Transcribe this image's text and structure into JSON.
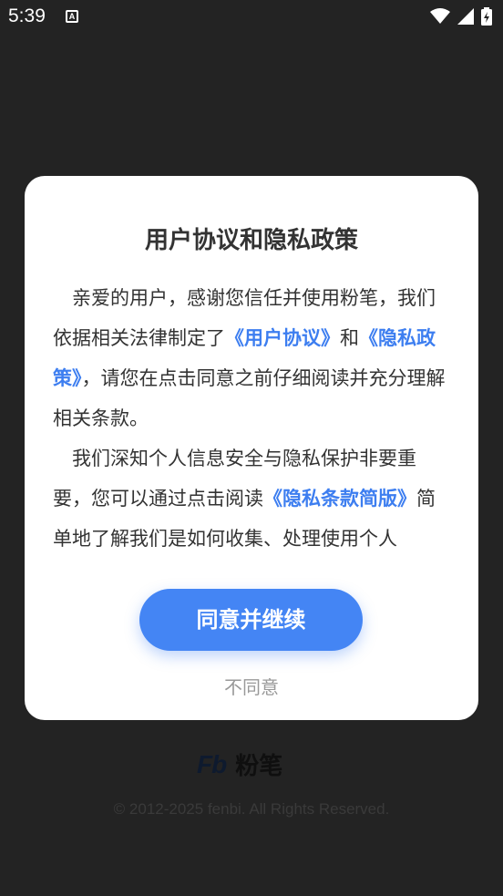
{
  "status_bar": {
    "time": "5:39",
    "notification_icon": "a-icon",
    "icons": [
      "wifi-icon",
      "signal-icon",
      "battery-charging-icon"
    ]
  },
  "dialog": {
    "title": "用户协议和隐私政策",
    "paragraph1": {
      "part1": "亲爱的用户，感谢您信任并使用粉笔，我们依据相关法律制定了",
      "link_user_agreement": "《用户协议》",
      "part2": "和",
      "link_privacy_policy": "《隐私政策》",
      "part3": "，请您在点击同意之前仔细阅读并充分理解相关条款。"
    },
    "paragraph2": {
      "part1": "我们深知个人信息安全与隐私保护非要重要，您可以通过点击阅读",
      "link_privacy_summary": "《隐私条款简版》",
      "part2": "简单地了解我们是如何收集、处理使用个人"
    },
    "agree_label": "同意并继续",
    "disagree_label": "不同意"
  },
  "background": {
    "brand_logo": "Fb",
    "brand_name": "粉笔",
    "copyright": "© 2012-2025 fenbi. All Rights Reserved."
  },
  "colors": {
    "accent": "#4485f4",
    "link": "#3d7ef0",
    "overlay_bg": "#232323",
    "text": "#333333",
    "muted": "#999999"
  }
}
